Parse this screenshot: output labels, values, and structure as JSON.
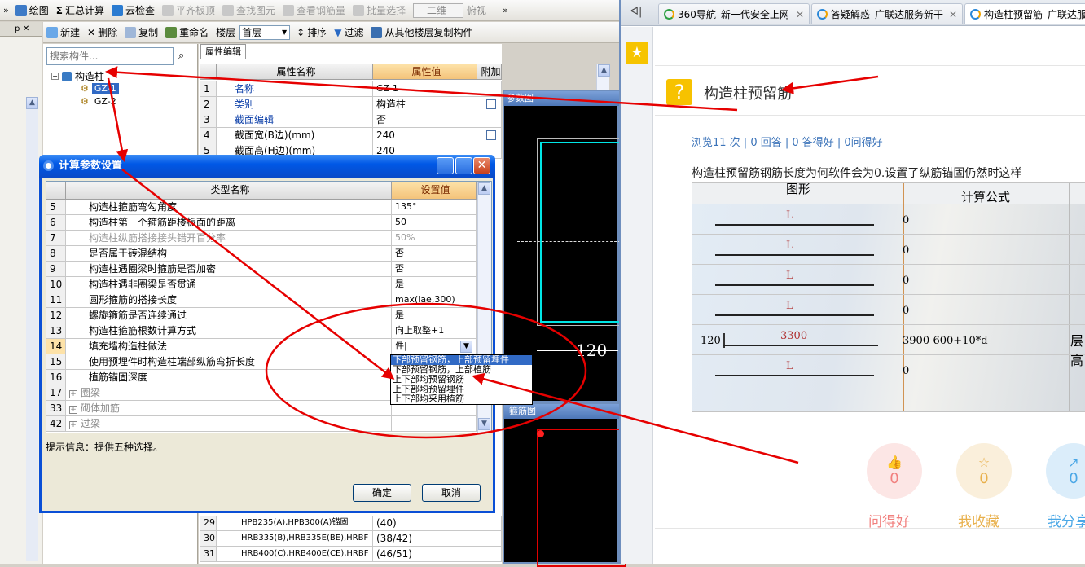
{
  "app": {
    "toolbar1": [
      {
        "label": "绘图",
        "enabled": true
      },
      {
        "label": "汇总计算",
        "enabled": true
      },
      {
        "label": "云检查",
        "enabled": true
      },
      {
        "label": "平齐板顶",
        "enabled": false
      },
      {
        "label": "查找图元",
        "enabled": false
      },
      {
        "label": "查看钢筋量",
        "enabled": false
      },
      {
        "label": "批量选择",
        "enabled": false
      }
    ],
    "view_select": "二维",
    "view_mode": "俯视",
    "toolbar2": {
      "new": "新建",
      "delete": "删除",
      "copy": "复制",
      "rename": "重命名",
      "floor_label": "楼层",
      "floor_value": "首层",
      "sort": "排序",
      "filter": "过滤",
      "copy_from": "从其他楼层复制构件"
    },
    "search_placeholder": "搜索构件...",
    "tree": {
      "root": "构造柱",
      "children": [
        "GZ-1",
        "GZ-2"
      ]
    },
    "prop_tab": "属性编辑",
    "prop_headers": {
      "name": "属性名称",
      "value": "属性值",
      "extra": "附加"
    },
    "props": [
      {
        "num": "1",
        "name": "名称",
        "value": "GZ-1",
        "check": false
      },
      {
        "num": "2",
        "name": "类别",
        "value": "构造柱",
        "check": true
      },
      {
        "num": "3",
        "name": "截面编辑",
        "value": "否",
        "check": false
      },
      {
        "num": "4",
        "name": "截面宽(B边)(mm)",
        "value": "240",
        "check": true
      },
      {
        "num": "5",
        "name": "截面高(H边)(mm)",
        "value": "240",
        "check": false
      }
    ],
    "props_bottom": [
      {
        "num": "29",
        "name": "HPB235(A),HPB300(A)锚固",
        "value": "(40)"
      },
      {
        "num": "30",
        "name": "HRB335(B),HRB335E(BE),HRBF",
        "value": "(38/42)"
      },
      {
        "num": "31",
        "name": "HRB400(C),HRB400E(CE),HRBF",
        "value": "(46/51)"
      }
    ],
    "panel_titles": {
      "section": "参数图",
      "rebar": "箍筋图"
    },
    "dimension": "120"
  },
  "dialog": {
    "title": "计算参数设置",
    "headers": {
      "type": "类型名称",
      "value": "设置值"
    },
    "rows": [
      {
        "num": "5",
        "name": "构造柱箍筋弯勾角度",
        "value": "135°",
        "dim": false
      },
      {
        "num": "6",
        "name": "构造柱第一个箍筋距楼板面的距离",
        "value": "50",
        "dim": false
      },
      {
        "num": "7",
        "name": "构造柱纵筋搭接接头错开百分率",
        "value": "50%",
        "dim": true
      },
      {
        "num": "8",
        "name": "是否属于砖混结构",
        "value": "否",
        "dim": false
      },
      {
        "num": "9",
        "name": "构造柱遇圈梁时箍筋是否加密",
        "value": "否",
        "dim": false
      },
      {
        "num": "10",
        "name": "构造柱遇非圈梁是否贯通",
        "value": "是",
        "dim": false
      },
      {
        "num": "11",
        "name": "圆形箍筋的搭接长度",
        "value": "max(lae,300)",
        "dim": false
      },
      {
        "num": "12",
        "name": "螺旋箍筋是否连续通过",
        "value": "是",
        "dim": false
      },
      {
        "num": "13",
        "name": "构造柱箍筋根数计算方式",
        "value": "向上取整+1",
        "dim": false
      },
      {
        "num": "14",
        "name": "填充墙构造柱做法",
        "value": "件|",
        "dim": false,
        "highlight": true
      },
      {
        "num": "15",
        "name": "使用预埋件时构造柱端部纵筋弯折长度",
        "value": "",
        "dim": false
      },
      {
        "num": "16",
        "name": "植筋锚固深度",
        "value": "",
        "dim": false
      }
    ],
    "groups": [
      {
        "num": "17",
        "name": "圈梁"
      },
      {
        "num": "33",
        "name": "砌体加筋"
      },
      {
        "num": "42",
        "name": "过梁"
      }
    ],
    "dropdown": [
      "下部预留钢筋，上部预留埋件",
      "下部预留钢筋，上部植筋",
      "上下部均预留钢筋",
      "上下部均预留埋件",
      "上下部均采用植筋"
    ],
    "hint": "提示信息：提供五种选择。",
    "ok": "确定",
    "cancel": "取消"
  },
  "browser": {
    "tabs": [
      {
        "label": "360导航_新一代安全上网"
      },
      {
        "label": "答疑解惑_广联达服务新干"
      },
      {
        "label": "构造柱预留筋_广联达服务"
      }
    ],
    "question_title": "构造柱预留筋",
    "stats": "浏览11 次 | 0 回答 | 0 答得好 | 0问得好",
    "body": "构造柱预留筋钢筋长度为何软件会为0.设置了纵筋锚固仍然时这样",
    "image_headers": {
      "shape": "图形",
      "formula": "计算公式"
    },
    "image_rows": [
      {
        "label": "L",
        "value": "0"
      },
      {
        "label": "L",
        "value": "0"
      },
      {
        "label": "L",
        "value": "0"
      },
      {
        "label": "L",
        "value": "0"
      },
      {
        "label": "3300",
        "prefix": "120",
        "value": "3900-600+10*d",
        "side": "层高"
      },
      {
        "label": "L",
        "value": "0"
      }
    ],
    "reactions": [
      {
        "label": "问得好",
        "count": "0",
        "color": "#f1807e"
      },
      {
        "label": "我收藏",
        "count": "0",
        "color": "#e8b04c"
      },
      {
        "label": "我分享",
        "count": "0",
        "color": "#4aa7e6"
      }
    ]
  },
  "annotation_color": "#e60000"
}
